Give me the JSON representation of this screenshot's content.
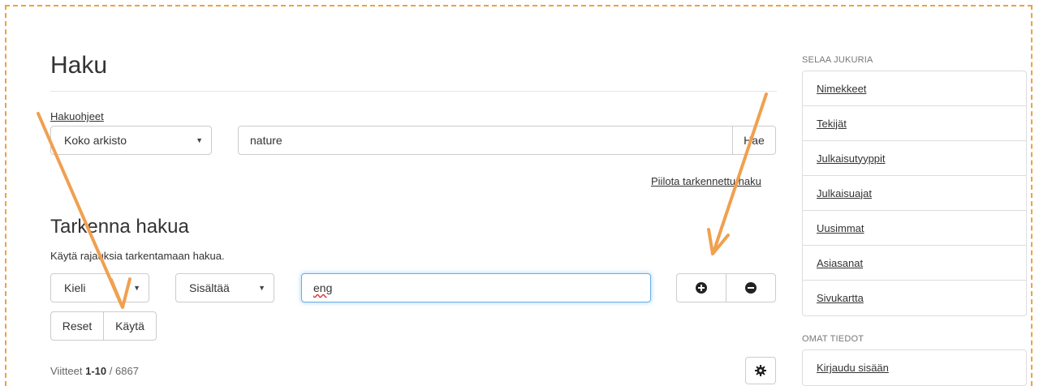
{
  "page": {
    "title": "Haku",
    "help_link": "Hakuohjeet"
  },
  "search": {
    "scope": "Koko arkisto",
    "query": "nature",
    "submit_label": "Hae",
    "toggle_advanced": "Piilota tarkennettu haku"
  },
  "refine": {
    "title": "Tarkenna hakua",
    "hint": "Käytä rajauksia tarkentamaan hakua.",
    "field": "Kieli",
    "operator": "Sisältää",
    "value": "eng",
    "reset_label": "Reset",
    "apply_label": "Käytä"
  },
  "results": {
    "prefix": "Viitteet ",
    "range": "1-10",
    "separator": " / ",
    "total": "6867"
  },
  "sidebar": {
    "browse_heading": "SELAA JUKURIA",
    "browse_items": [
      {
        "label": "Nimekkeet"
      },
      {
        "label": "Tekijät"
      },
      {
        "label": "Julkaisutyyppit"
      },
      {
        "label": "Julkaisuajat"
      },
      {
        "label": "Uusimmat"
      },
      {
        "label": "Asiasanat"
      },
      {
        "label": "Sivukartta"
      }
    ],
    "account_heading": "OMAT TIEDOT",
    "account_items": [
      {
        "label": "Kirjaudu sisään"
      }
    ]
  },
  "colors": {
    "frame": "#f0a040",
    "arrow": "#f0a050",
    "focus_border": "#66afe9"
  },
  "icons": {
    "add": "plus-circle-icon",
    "remove": "minus-circle-icon",
    "settings": "gear-icon"
  }
}
